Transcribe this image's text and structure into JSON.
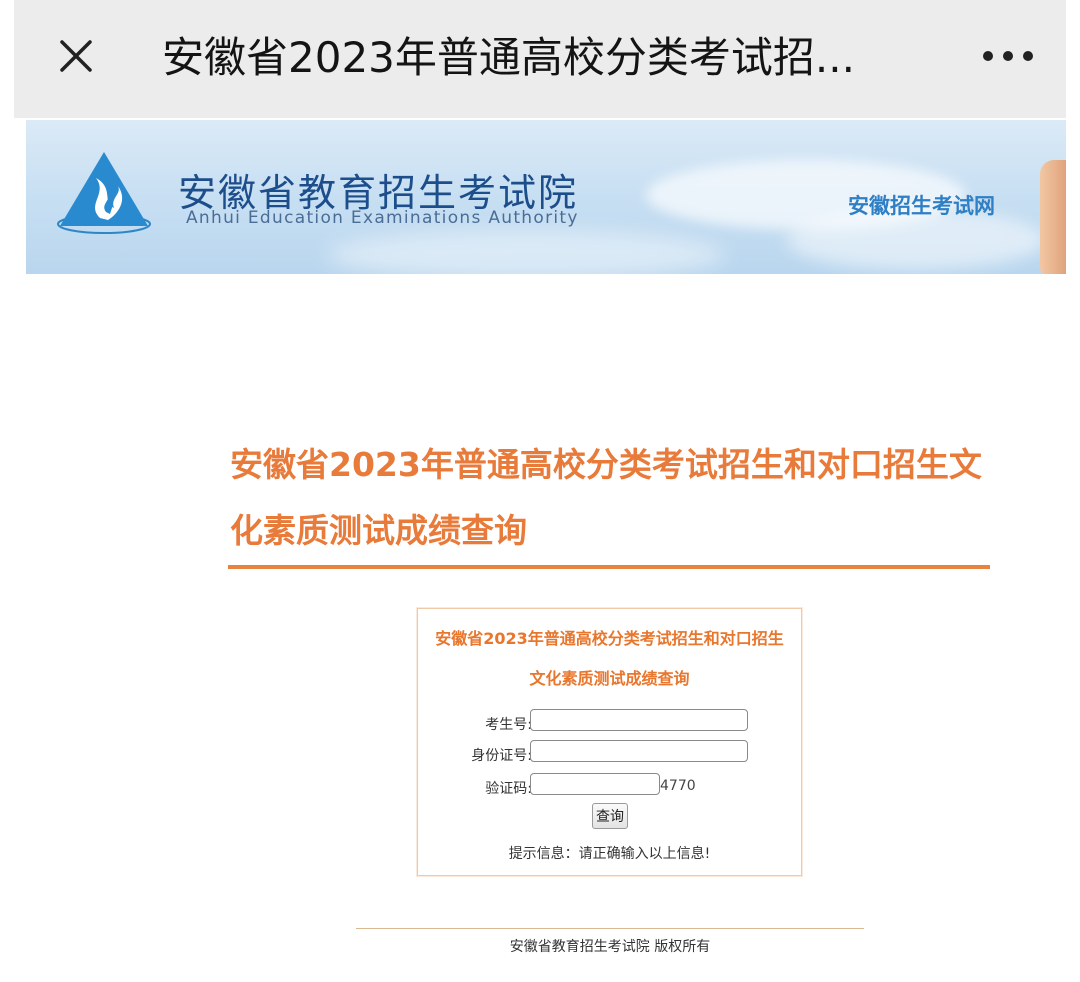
{
  "topbar": {
    "title": "安徽省2023年普通高校分类考试招...",
    "close_icon": "close-icon",
    "more_icon": "more-dots-icon"
  },
  "banner": {
    "org_name_cn": "安徽省教育招生考试院",
    "org_name_en": "Anhui Education Examinations Authority",
    "site_name": "安徽招生考试网",
    "logo_icon": "flame-triangle-logo-icon"
  },
  "main": {
    "title": "安徽省2023年普通高校分类考试招生和对口招生文化素质测试成绩查询"
  },
  "query_form": {
    "title": "安徽省2023年普通高校分类考试招生和对口招生文化素质测试成绩查询",
    "exam_number_label": "考生号:",
    "exam_number_value": "",
    "id_number_label": "身份证号:",
    "id_number_value": "",
    "captcha_label": "验证码:",
    "captcha_value": "",
    "captcha_code": "4770",
    "submit_label": "查询",
    "hint": "提示信息：请正确输入以上信息!"
  },
  "footer": {
    "copyright": "安徽省教育招生考试院 版权所有"
  },
  "colors": {
    "accent_orange": "#e87a3a",
    "brand_blue": "#1d4e8c",
    "topbar_bg": "#ececec"
  }
}
